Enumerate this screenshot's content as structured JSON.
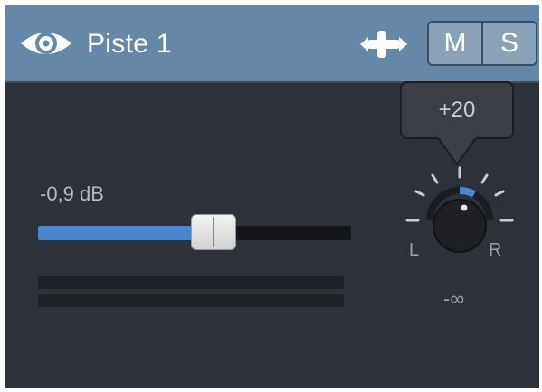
{
  "track": {
    "name": "Piste 1",
    "mute_label": "M",
    "solo_label": "S"
  },
  "volume": {
    "label": "-0,9 dB",
    "fader_level_fraction": 0.56
  },
  "pan": {
    "tooltip": "+20",
    "left_label": "L",
    "right_label": "R",
    "readout": "-∞"
  },
  "colors": {
    "header": "#6588a9",
    "panel": "#2d3139",
    "fader_fill": "#4a86d0",
    "knob_indicator": "#4a86d0"
  },
  "icons": {
    "visibility": "eye-icon",
    "move": "move-handle-icon"
  }
}
